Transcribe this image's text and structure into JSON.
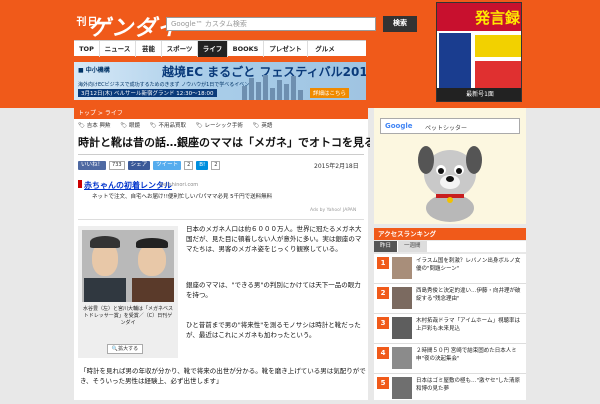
{
  "header": {
    "logo_small": "日刊",
    "logo_big": "ゲンダイ",
    "search_placeholder": "Google™ カスタム検索",
    "search_button": "検索",
    "nav": [
      "TOP",
      "ニュース",
      "芸能",
      "スポーツ",
      "ライフ",
      "BOOKS",
      "プレゼント",
      "グルメ"
    ],
    "active_nav": "ライフ",
    "brand_color": "#f05a1a"
  },
  "ad_banner": {
    "line1": "■ 中小機構",
    "title": "越境EC まるごと フェスティバル2015",
    "line2": "海外向けECビジネスで成功するためのきまず ノウハウが1日で学べるイベント",
    "line3": "3月12日(木) ベルサール新宿グランド 12:30～18:00",
    "cta": "詳細はこちら"
  },
  "magazine": {
    "headline": "発言録",
    "label": "最新号1面"
  },
  "article": {
    "breadcrumb": "トップ > ライフ",
    "tags": [
      "吉本 興勲",
      "眼鏡",
      "不用品買取",
      "レーシック手術",
      "英語"
    ],
    "title": "時計と靴は昔の話…銀座のママは「メガネ」でオトコを見る",
    "share": {
      "like_label": "いいね！",
      "like_count": "733",
      "share_label": "シェア",
      "tweet_label": "ツイート",
      "tweet_count": "2",
      "hatena_count": "2"
    },
    "date": "2015年2月18日",
    "ad": {
      "title": "赤ちゃんの初着レンタル",
      "url": "bellshinori.com",
      "desc": "ネットで注文、自宅へお届け!!便利忙しいパパママ必見 5千円で送料無料",
      "byline": "Ads by Yahoo! JAPAN"
    },
    "photo_caption": "水谷豊（左）と宮川大輔は「メガネベストドレッサー賞」を受賞／（C）日刊ゲンダイ",
    "zoom_label": "拡大する",
    "paragraphs": [
      "日本のメガネ人口は約６０００万人。世界に冠たるメガネ大国だが、見た目に頓着しない人が意外に多い。実は銀座のママたちは、男客のメガネ姿をじっくり観察している。",
      "銀座のママは、\"できる男\"の判別にかけては天下一品の眼力を持つ。",
      "ひと昔前まで男の\"将来性\"を測るモノサシは時計と靴だったが、最近はこれにメガネも加わったという。",
      "「時計を見れば男の年収が分かり、靴で将来の出世が分かる。靴を磨き上げている男は気配りができ、そういった男性は経験上、必ず出世します」"
    ]
  },
  "sidebar": {
    "google_label": "Google",
    "google_query": "ペットシッター",
    "ranking_header": "アクセスランキング",
    "tabs": [
      "昨日",
      "一週間"
    ],
    "active_tab": "昨日",
    "ranking": [
      {
        "rank": "1",
        "text": "イラスム国を刺激？レバノン出身ボルノ女優の\"問題シーン\""
      },
      {
        "rank": "2",
        "text": "西島秀俊と決定的違い…伊藤・向井理が破綻する\"残念理由\""
      },
      {
        "rank": "3",
        "text": "木村拓哉ドラマ「アイムホーム」視聴率は上戸彩も未来見込"
      },
      {
        "rank": "4",
        "text": "２時間５０円 宮崎で結束固めた日本人ミ申\"夜の決起集会\""
      },
      {
        "rank": "5",
        "text": "日本はゴミ屋敷の極も…\"激ヤセ\"した清原和博の見た夢"
      }
    ]
  }
}
